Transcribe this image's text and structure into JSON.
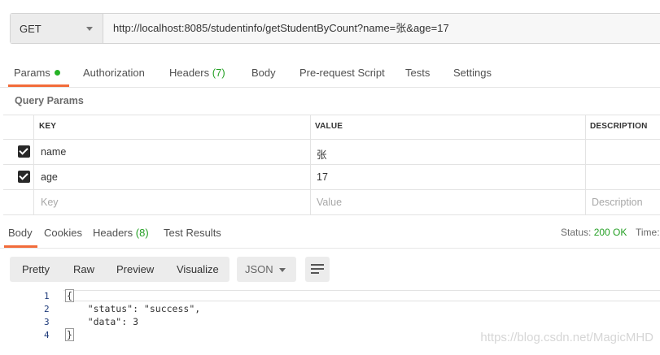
{
  "request": {
    "method": "GET",
    "url": "http://localhost:8085/studentinfo/getStudentByCount?name=张&age=17"
  },
  "request_tabs": [
    {
      "label": "Params",
      "badge": ""
    },
    {
      "label": "Authorization",
      "badge": ""
    },
    {
      "label": "Headers",
      "badge": "(7)"
    },
    {
      "label": "Body",
      "badge": ""
    },
    {
      "label": "Pre-request Script",
      "badge": ""
    },
    {
      "label": "Tests",
      "badge": ""
    },
    {
      "label": "Settings",
      "badge": ""
    }
  ],
  "query_params": {
    "title": "Query Params",
    "headers": {
      "key": "KEY",
      "value": "VALUE",
      "description": "DESCRIPTION"
    },
    "rows": [
      {
        "checked": true,
        "key": "name",
        "value": "张",
        "description": ""
      },
      {
        "checked": true,
        "key": "age",
        "value": "17",
        "description": ""
      }
    ],
    "placeholder": {
      "key": "Key",
      "value": "Value",
      "description": "Description"
    }
  },
  "response_tabs": [
    {
      "label": "Body",
      "badge": ""
    },
    {
      "label": "Cookies",
      "badge": ""
    },
    {
      "label": "Headers",
      "badge": "(8)"
    },
    {
      "label": "Test Results",
      "badge": ""
    }
  ],
  "response_status": {
    "label": "Status:",
    "value": "200 OK",
    "time_label": "Time:"
  },
  "view_modes": [
    "Pretty",
    "Raw",
    "Preview",
    "Visualize"
  ],
  "format": "JSON",
  "code_lines": [
    {
      "n": "1",
      "text": "{"
    },
    {
      "n": "2",
      "text": "    \"status\": \"success\","
    },
    {
      "n": "3",
      "text": "    \"data\": 3"
    },
    {
      "n": "4",
      "text": "}"
    }
  ],
  "watermark": "https://blog.csdn.net/MagicMHD"
}
